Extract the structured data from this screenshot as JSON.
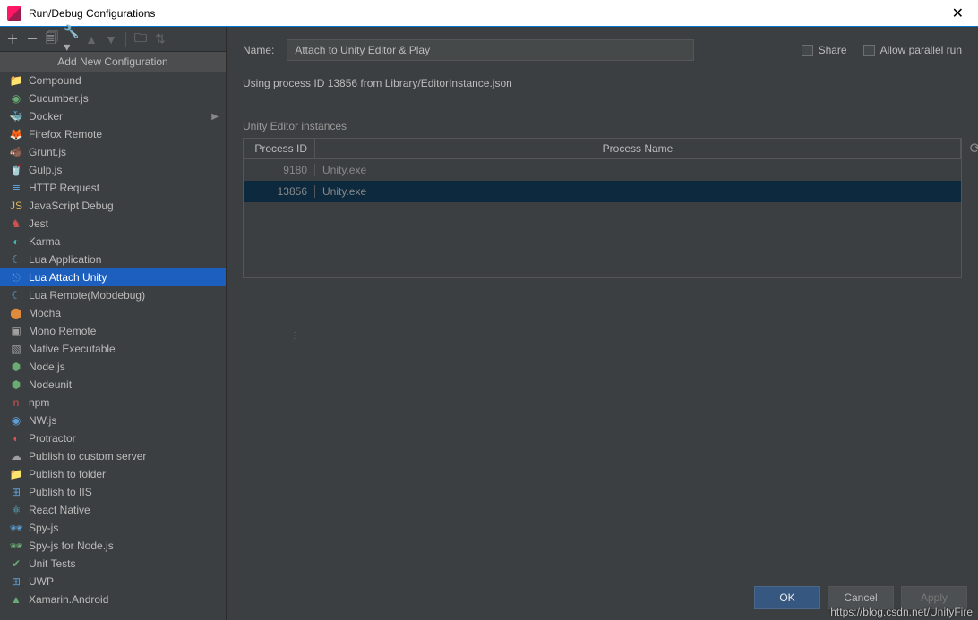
{
  "window": {
    "title": "Run/Debug Configurations"
  },
  "panel_header": "Add New Configuration",
  "config_items": [
    {
      "label": "Compound",
      "icon": "📁",
      "cls": "c-teal"
    },
    {
      "label": "Cucumber.js",
      "icon": "◉",
      "cls": "c-green"
    },
    {
      "label": "Docker",
      "icon": "🐳",
      "cls": "c-cyan",
      "expand": true
    },
    {
      "label": "Firefox Remote",
      "icon": "🦊",
      "cls": "c-orange"
    },
    {
      "label": "Grunt.js",
      "icon": "🐗",
      "cls": "c-orange"
    },
    {
      "label": "Gulp.js",
      "icon": "🥤",
      "cls": "c-red"
    },
    {
      "label": "HTTP Request",
      "icon": "≣",
      "cls": "c-blue"
    },
    {
      "label": "JavaScript Debug",
      "icon": "JS",
      "cls": "c-yellow"
    },
    {
      "label": "Jest",
      "icon": "♞",
      "cls": "c-red"
    },
    {
      "label": "Karma",
      "icon": "◐",
      "cls": "c-teal"
    },
    {
      "label": "Lua Application",
      "icon": "☾",
      "cls": "c-blue"
    },
    {
      "label": "Lua Attach Unity",
      "icon": "⎋",
      "cls": "c-blue",
      "selected": true
    },
    {
      "label": "Lua Remote(Mobdebug)",
      "icon": "☾",
      "cls": "c-blue"
    },
    {
      "label": "Mocha",
      "icon": "⬤",
      "cls": "c-orange"
    },
    {
      "label": "Mono Remote",
      "icon": "▣",
      "cls": "c-gray"
    },
    {
      "label": "Native Executable",
      "icon": "▧",
      "cls": "c-gray"
    },
    {
      "label": "Node.js",
      "icon": "⬢",
      "cls": "c-green"
    },
    {
      "label": "Nodeunit",
      "icon": "⬢",
      "cls": "c-green"
    },
    {
      "label": "npm",
      "icon": "n",
      "cls": "c-red"
    },
    {
      "label": "NW.js",
      "icon": "◉",
      "cls": "c-blue"
    },
    {
      "label": "Protractor",
      "icon": "◐",
      "cls": "c-red"
    },
    {
      "label": "Publish to custom server",
      "icon": "☁",
      "cls": "c-gray"
    },
    {
      "label": "Publish to folder",
      "icon": "📁",
      "cls": "c-gray"
    },
    {
      "label": "Publish to IIS",
      "icon": "⊞",
      "cls": "c-blue"
    },
    {
      "label": "React Native",
      "icon": "⚛",
      "cls": "c-cyan"
    },
    {
      "label": "Spy-js",
      "icon": "🕶",
      "cls": "c-blue"
    },
    {
      "label": "Spy-js for Node.js",
      "icon": "🕶",
      "cls": "c-green"
    },
    {
      "label": "Unit Tests",
      "icon": "✔",
      "cls": "c-green"
    },
    {
      "label": "UWP",
      "icon": "⊞",
      "cls": "c-blue"
    },
    {
      "label": "Xamarin.Android",
      "icon": "▲",
      "cls": "c-green"
    }
  ],
  "form": {
    "name_label": "Name:",
    "name_value": "Attach to Unity Editor & Play",
    "share_label": "Share",
    "parallel_label": "Allow parallel run",
    "info": "Using process ID 13856 from Library/EditorInstance.json",
    "section": "Unity Editor instances",
    "columns": {
      "pid": "Process ID",
      "pname": "Process Name"
    },
    "rows": [
      {
        "pid": "9180",
        "name": "Unity.exe",
        "selected": false
      },
      {
        "pid": "13856",
        "name": "Unity.exe",
        "selected": true
      }
    ]
  },
  "buttons": {
    "ok": "OK",
    "cancel": "Cancel",
    "apply": "Apply"
  },
  "watermark": "https://blog.csdn.net/UnityFire"
}
